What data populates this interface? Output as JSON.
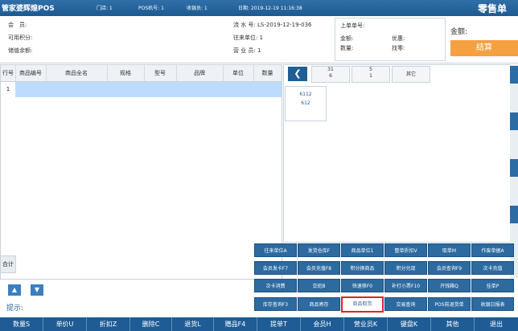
{
  "titlebar": {
    "app_name": "管家婆辉煌POS",
    "store": "门店: 1",
    "pos_no": "POS机号: 1",
    "cashier": "收银员: 1",
    "datetime": "日期: 2019-12-19 11:16:38",
    "mode": "零售单"
  },
  "info": {
    "member_label": "会　员:",
    "points_label": "可用积分:",
    "balance_label": "储值余额:",
    "serial": "流 水 号: LS-2019-12-19-036",
    "company": "往来单位: 1",
    "salesman": "营 业 员: 1"
  },
  "last_order": {
    "title": "上单单号:",
    "amount_label": "金额:",
    "discount_label": "优惠:",
    "qty_label": "数量:",
    "change_label": "找零:"
  },
  "total": {
    "label": "金额:",
    "checkout": "结算"
  },
  "table": {
    "headers": [
      "行号",
      "商品编号",
      "商品全名",
      "规格",
      "型号",
      "品牌",
      "单位",
      "数量"
    ],
    "rows": [
      {
        "num": "1"
      }
    ],
    "sum_label": "合计"
  },
  "goods": {
    "categories": [
      {
        "line1": "31",
        "line2": "6"
      },
      {
        "line1": "5",
        "line2": "1"
      },
      {
        "line1": "其它",
        "line2": ""
      }
    ],
    "item_code": "6112",
    "item_name": "612"
  },
  "functions": [
    "往来单位A",
    "发货仓库F",
    "商品单位1",
    "整单折扣V",
    "取单M",
    "作废单据A",
    "会员发卡F7",
    "会员充值F8",
    "积分换商品",
    "积分兑现",
    "会员查询F9",
    "次卡充值",
    "次卡消费",
    "交班B",
    "快速移F0",
    "补打小票F10",
    "开钱箱Q",
    "挂单P",
    "库存查询F3",
    "商品寄存",
    "商品取货",
    "交易查询",
    "POS前退货单",
    "收银日报表"
  ],
  "highlighted_function": "商品取货",
  "hint": "提示:",
  "bottom": [
    "数量S",
    "单价U",
    "折扣Z",
    "删除C",
    "退货L",
    "赠品F4",
    "提单T",
    "会员H",
    "营业员K",
    "键盘K",
    "其他",
    "退出"
  ]
}
